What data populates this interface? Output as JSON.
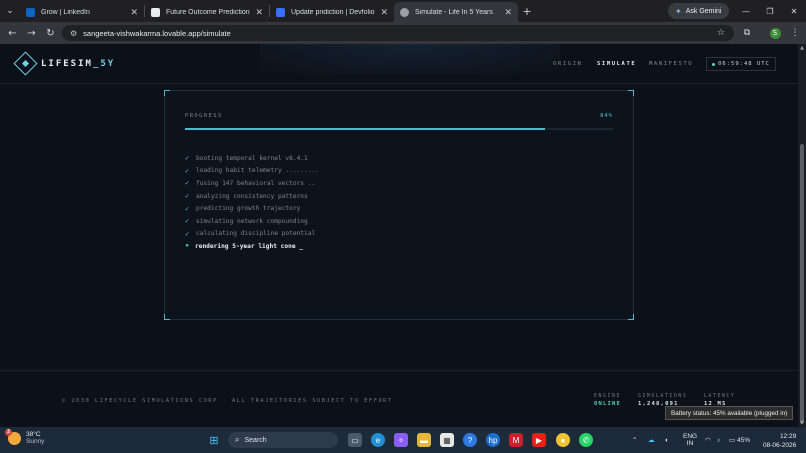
{
  "browser": {
    "tabs": [
      {
        "label": "Grow | LinkedIn",
        "color": "#0a66c2",
        "active": false
      },
      {
        "label": "Future Outcome Prediction",
        "color": "#e8eaed",
        "active": false
      },
      {
        "label": "Update pridiction | Devfolio",
        "color": "#3770ff",
        "active": false
      },
      {
        "label": "Simulate - Life In 5 Years",
        "color": "#9aa0a6",
        "active": true
      }
    ],
    "new_tab": "+",
    "gemini_label": "Ask Gemini",
    "url": "sangeeta-vishwakarma.lovable.app/simulate",
    "profile_initial": "S"
  },
  "site": {
    "logo_prefix": "LIFESIM",
    "logo_suffix": "_5Y",
    "nav": [
      {
        "label": "ORIGIN",
        "active": false
      },
      {
        "label": "SIMULATE",
        "active": true
      },
      {
        "label": "MANIFESTO",
        "active": false
      }
    ],
    "clock": "06:59:48 UTC"
  },
  "progress": {
    "label": "PROGRESS",
    "value_text": "84%",
    "fraction": 0.84
  },
  "log": {
    "done": [
      "booting temporal kernel v8.4.1",
      "loading habit telemetry .........",
      "fusing 147 behavioral vectors ..",
      "analyzing consistency patterns",
      "predicting growth trajectory",
      "simulating network compounding",
      "calculating discipline potential"
    ],
    "current": "rendering 5-year light cone  _"
  },
  "footer": {
    "copyright": "© 2030 LIFECYCLE SIMULATIONS CORP · ALL TRAJECTORIES SUBJECT TO EFFORT",
    "stats": [
      {
        "key": "ENGINE",
        "value": "ONLINE",
        "ok": true
      },
      {
        "key": "SIMULATIONS",
        "value": "1,248,091",
        "ok": false
      },
      {
        "key": "LATENCY",
        "value": "12 MS",
        "ok": false
      }
    ]
  },
  "tooltip": "Battery status: 45% available (plugged in)",
  "taskbar": {
    "weather_temp": "38°C",
    "weather_cond": "Sunny",
    "weather_badge": "2",
    "search_label": "Search",
    "lang_line1": "ENG",
    "lang_line2": "IN",
    "battery": "45%",
    "time": "12:29",
    "date": "08-06-2026"
  }
}
